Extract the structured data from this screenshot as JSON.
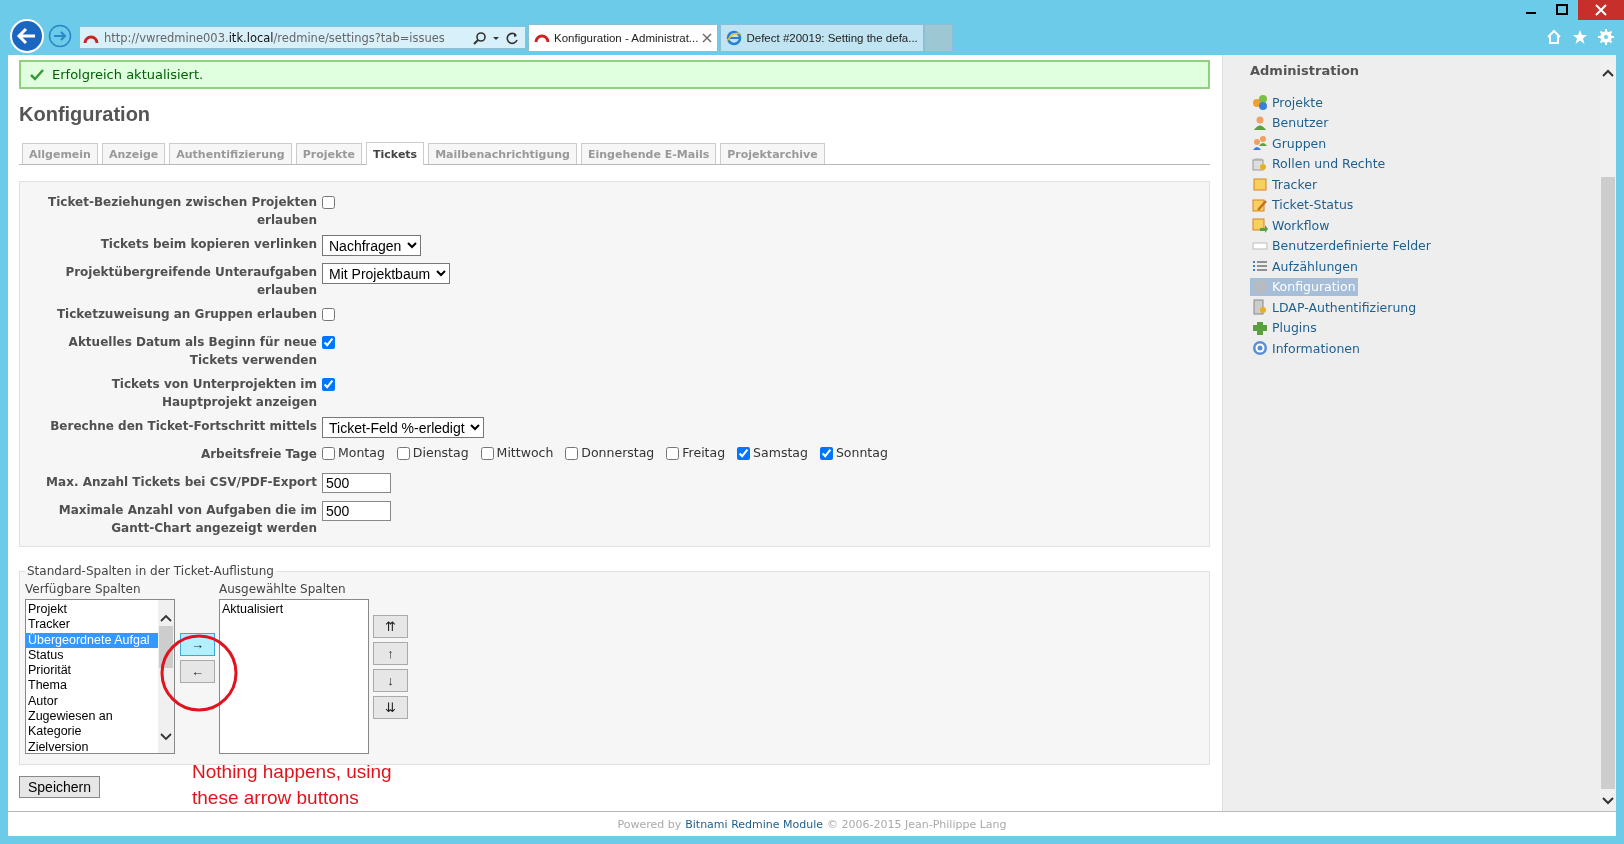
{
  "browser": {
    "url": {
      "before": "http://vwredmine003.",
      "domain": "itk.local",
      "after": "/redmine/settings?tab=issues"
    },
    "tabs": [
      {
        "title": "Konfiguration - Administrat...",
        "selected": true
      },
      {
        "title": "Defect #20019: Setting the defa...",
        "selected": false
      }
    ]
  },
  "flash": "Erfolgreich aktualisiert.",
  "title": "Konfiguration",
  "tabs": [
    {
      "label": "Allgemein",
      "selected": false
    },
    {
      "label": "Anzeige",
      "selected": false
    },
    {
      "label": "Authentifizierung",
      "selected": false
    },
    {
      "label": "Projekte",
      "selected": false
    },
    {
      "label": "Tickets",
      "selected": true
    },
    {
      "label": "Mailbenachrichtigung",
      "selected": false
    },
    {
      "label": "Eingehende E-Mails",
      "selected": false
    },
    {
      "label": "Projektarchive",
      "selected": false
    }
  ],
  "settings": [
    {
      "kind": "checkbox",
      "label": "Ticket-Beziehungen zwischen Projekten erlauben",
      "checked": false
    },
    {
      "kind": "select",
      "label": "Tickets beim kopieren verlinken",
      "value": "Nachfragen"
    },
    {
      "kind": "select",
      "label": "Projektübergreifende Unteraufgaben erlauben",
      "value": "Mit Projektbaum"
    },
    {
      "kind": "checkbox",
      "label": "Ticketzuweisung an Gruppen erlauben",
      "checked": false
    },
    {
      "kind": "checkbox",
      "label": "Aktuelles Datum als Beginn für neue Tickets verwenden",
      "checked": true
    },
    {
      "kind": "checkbox",
      "label": "Tickets von Unterprojekten im Hauptprojekt anzeigen",
      "checked": true
    },
    {
      "kind": "select",
      "label": "Berechne den Ticket-Fortschritt mittels",
      "value": "Ticket-Feld %-erledigt"
    },
    {
      "kind": "days",
      "label": "Arbeitsfreie Tage",
      "days": [
        {
          "label": "Montag",
          "checked": false
        },
        {
          "label": "Dienstag",
          "checked": false
        },
        {
          "label": "Mittwoch",
          "checked": false
        },
        {
          "label": "Donnerstag",
          "checked": false
        },
        {
          "label": "Freitag",
          "checked": false
        },
        {
          "label": "Samstag",
          "checked": true
        },
        {
          "label": "Sonntag",
          "checked": true
        }
      ]
    },
    {
      "kind": "text",
      "label": "Max. Anzahl Tickets bei CSV/PDF-Export",
      "value": "500"
    },
    {
      "kind": "text",
      "label": "Maximale Anzahl von Aufgaben die im Gantt-Chart angezeigt werden",
      "value": "500"
    }
  ],
  "columns": {
    "legend": "Standard-Spalten in der Ticket-Auflistung",
    "available_label": "Verfügbare Spalten",
    "selected_label": "Ausgewählte Spalten",
    "available": [
      {
        "label": "Projekt",
        "selected": false
      },
      {
        "label": "Tracker",
        "selected": false
      },
      {
        "label": "Übergeordnete Aufgal",
        "selected": true
      },
      {
        "label": "Status",
        "selected": false
      },
      {
        "label": "Priorität",
        "selected": false
      },
      {
        "label": "Thema",
        "selected": false
      },
      {
        "label": "Autor",
        "selected": false
      },
      {
        "label": "Zugewiesen an",
        "selected": false
      },
      {
        "label": "Kategorie",
        "selected": false
      },
      {
        "label": "Zielversion",
        "selected": false
      }
    ],
    "chosen": [
      {
        "label": "Aktualisiert",
        "selected": false
      }
    ],
    "move_buttons": [
      {
        "label": "→",
        "hover": true
      },
      {
        "label": "←",
        "hover": false
      }
    ],
    "order_buttons": [
      "⇈",
      "↑",
      "↓",
      "⇊"
    ]
  },
  "annotation": "Nothing happens, using these arrow buttons",
  "save": "Speichern",
  "sidebar": {
    "heading": "Administration",
    "items": [
      {
        "label": "Projekte",
        "selected": false
      },
      {
        "label": "Benutzer",
        "selected": false
      },
      {
        "label": "Gruppen",
        "selected": false
      },
      {
        "label": "Rollen und Rechte",
        "selected": false
      },
      {
        "label": "Tracker",
        "selected": false
      },
      {
        "label": "Ticket-Status",
        "selected": false
      },
      {
        "label": "Workflow",
        "selected": false
      },
      {
        "label": "Benutzerdefinierte Felder",
        "selected": false
      },
      {
        "label": "Aufzählungen",
        "selected": false
      },
      {
        "label": "Konfiguration",
        "selected": true
      },
      {
        "label": "LDAP-Authentifizierung",
        "selected": false
      },
      {
        "label": "Plugins",
        "selected": false
      },
      {
        "label": "Informationen",
        "selected": false
      }
    ]
  },
  "footer": {
    "before": "Powered by",
    "link": "Bitnami Redmine Module",
    "after": "© 2006-2015 Jean-Philippe Lang"
  }
}
